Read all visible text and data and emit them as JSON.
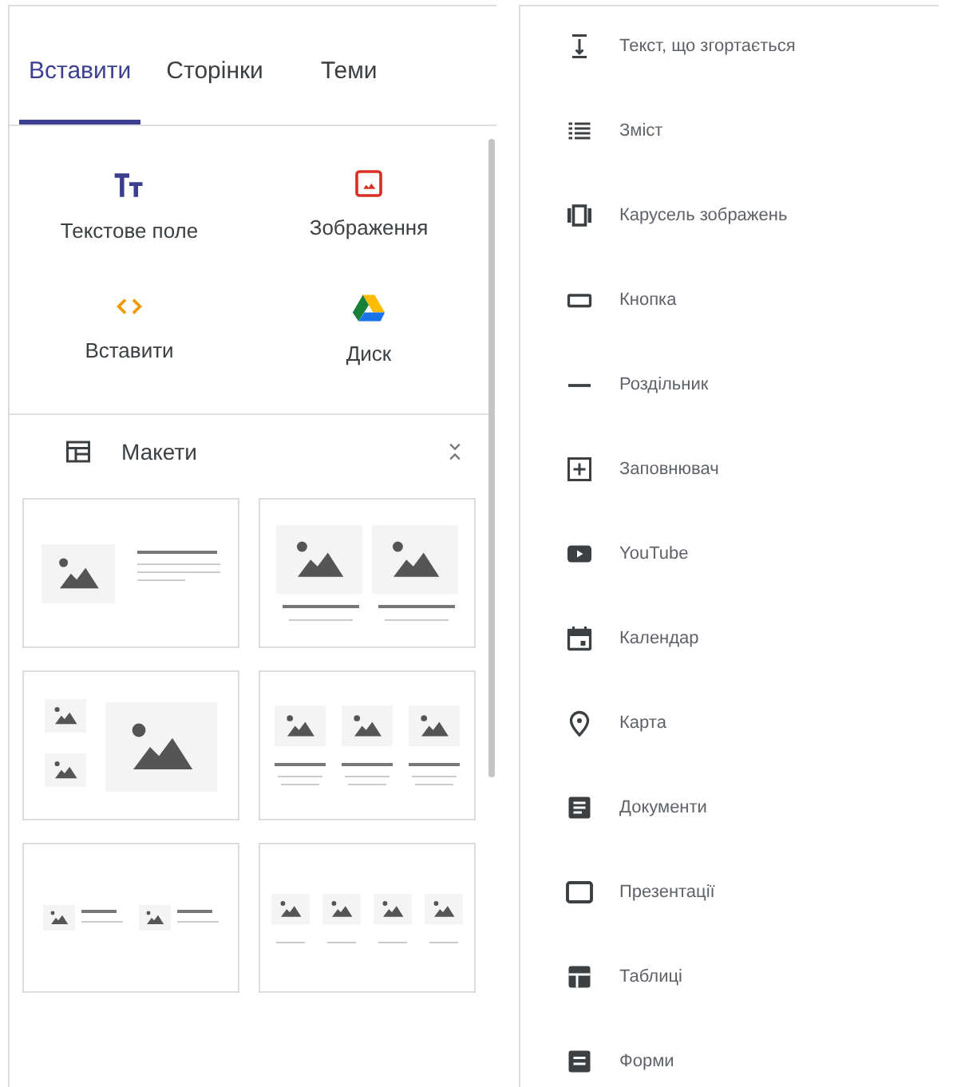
{
  "tabs": [
    {
      "label": "Вставити",
      "selected": true
    },
    {
      "label": "Сторінки",
      "selected": false
    },
    {
      "label": "Теми",
      "selected": false
    }
  ],
  "insert_items": [
    {
      "kind": "text",
      "label": "Текстове поле"
    },
    {
      "kind": "image",
      "label": "Зображення"
    },
    {
      "kind": "embed",
      "label": "Вставити"
    },
    {
      "kind": "drive",
      "label": "Диск"
    }
  ],
  "layouts": {
    "title": "Макети",
    "expanded": true,
    "items": [
      {
        "kind": "image-text"
      },
      {
        "kind": "two-cards"
      },
      {
        "kind": "three-images"
      },
      {
        "kind": "three-cards"
      },
      {
        "kind": "two-image-text"
      },
      {
        "kind": "four-cards"
      }
    ]
  },
  "components": [
    {
      "kind": "collapsible-text",
      "label": "Текст, що згортається"
    },
    {
      "kind": "toc",
      "label": "Зміст"
    },
    {
      "kind": "carousel",
      "label": "Карусель зображень"
    },
    {
      "kind": "button",
      "label": "Кнопка"
    },
    {
      "kind": "divider",
      "label": "Роздільник"
    },
    {
      "kind": "placeholder",
      "label": "Заповнювач"
    },
    {
      "kind": "youtube",
      "label": "YouTube"
    },
    {
      "kind": "calendar",
      "label": "Календар"
    },
    {
      "kind": "map",
      "label": "Карта"
    },
    {
      "kind": "docs",
      "label": "Документи"
    },
    {
      "kind": "slides",
      "label": "Презентації"
    },
    {
      "kind": "sheets",
      "label": "Таблиці"
    },
    {
      "kind": "forms",
      "label": "Форми"
    }
  ]
}
